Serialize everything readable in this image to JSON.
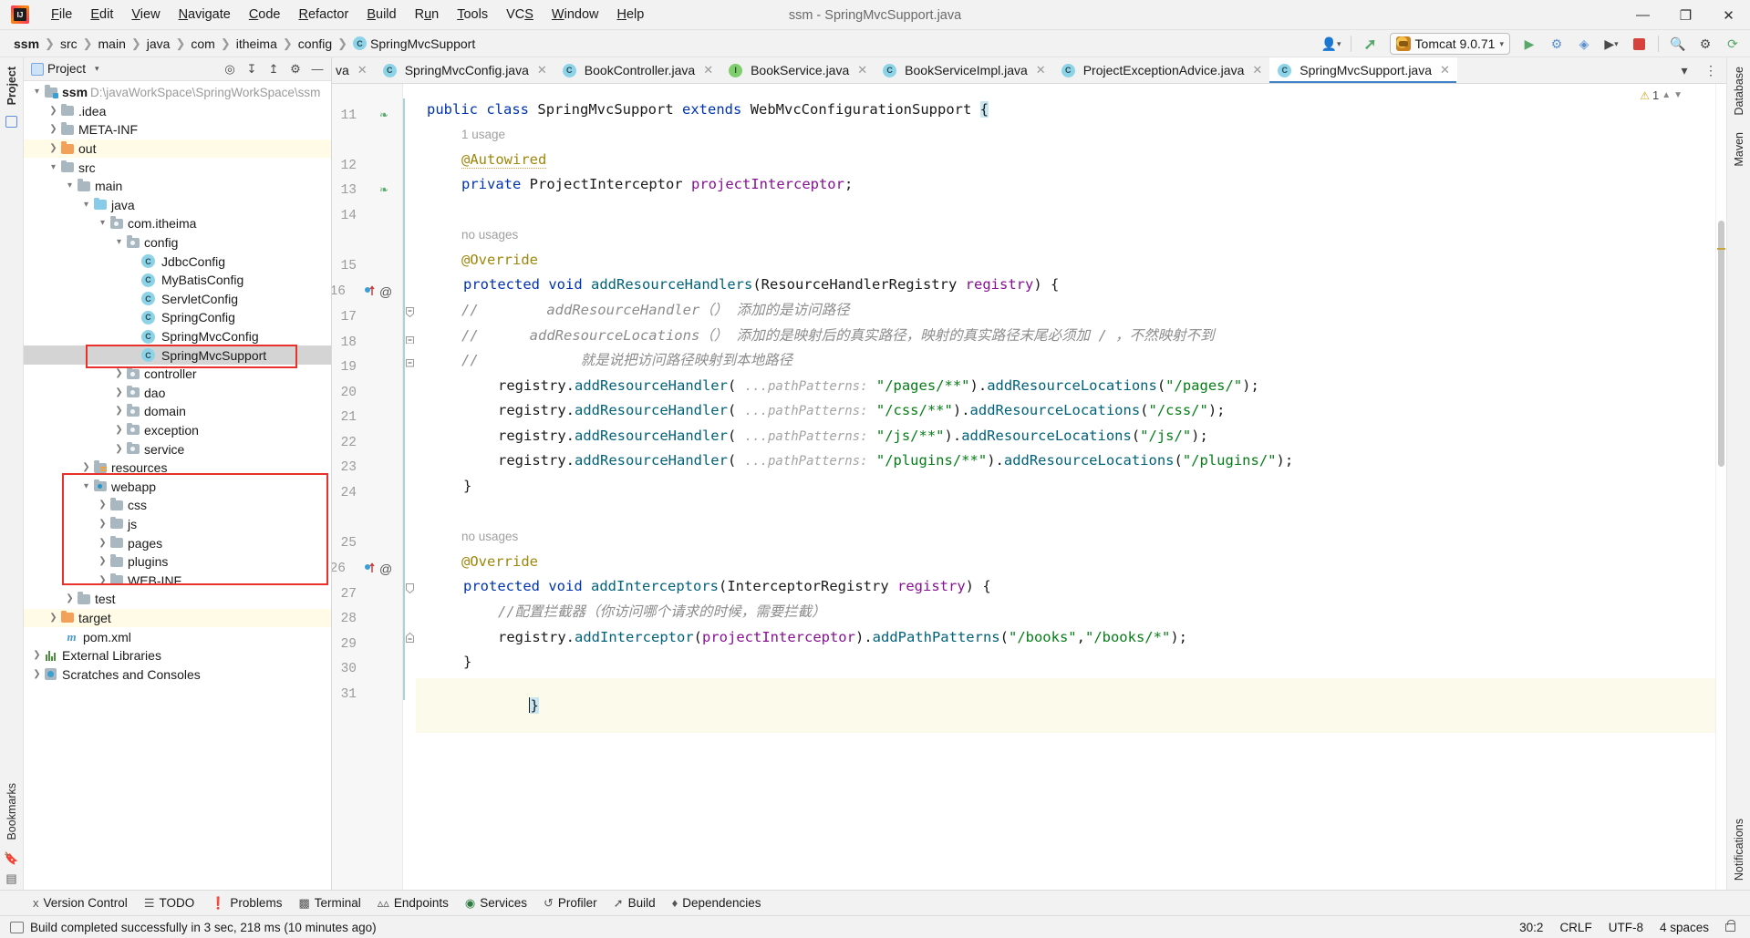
{
  "window": {
    "title": "ssm - SpringMvcSupport.java",
    "controls": {
      "minimize": "—",
      "maximize": "❐",
      "close": "✕"
    }
  },
  "menu": [
    {
      "label": "File"
    },
    {
      "label": "Edit"
    },
    {
      "label": "View"
    },
    {
      "label": "Navigate"
    },
    {
      "label": "Code"
    },
    {
      "label": "Refactor"
    },
    {
      "label": "Build"
    },
    {
      "label": "Run"
    },
    {
      "label": "Tools"
    },
    {
      "label": "VCS"
    },
    {
      "label": "Window"
    },
    {
      "label": "Help"
    }
  ],
  "breadcrumb": {
    "segments": [
      "ssm",
      "src",
      "main",
      "java",
      "com",
      "itheima",
      "config"
    ],
    "current": "SpringMvcSupport"
  },
  "toolbar": {
    "run_config": "Tomcat 9.0.71",
    "icons": [
      "profile-dropdown-icon",
      "hammer-build-icon",
      "run-icon",
      "debug-icon",
      "coverage-icon",
      "more-run-icon",
      "stop-icon",
      "search-everywhere-icon",
      "settings-icon",
      "updates-icon"
    ]
  },
  "project_panel": {
    "title": "Project",
    "header_icons": [
      "locate-icon",
      "collapse-all-icon",
      "expand-all-icon",
      "settings-icon",
      "hide-icon"
    ],
    "tree": [
      {
        "indent": 0,
        "arrow": "v",
        "icon": "module-folder",
        "label": "ssm",
        "bold": true,
        "path": "D:\\javaWorkSpace\\SpringWorkSpace\\ssm"
      },
      {
        "indent": 1,
        "arrow": ">",
        "icon": "folder",
        "label": ".idea"
      },
      {
        "indent": 1,
        "arrow": ">",
        "icon": "folder",
        "label": "META-INF"
      },
      {
        "indent": 1,
        "arrow": ">",
        "icon": "folder-orange",
        "label": "out",
        "highlight": "yellow"
      },
      {
        "indent": 1,
        "arrow": "v",
        "icon": "folder",
        "label": "src"
      },
      {
        "indent": 2,
        "arrow": "v",
        "icon": "folder",
        "label": "main"
      },
      {
        "indent": 3,
        "arrow": "v",
        "icon": "folder-blue",
        "label": "java"
      },
      {
        "indent": 4,
        "arrow": "v",
        "icon": "package",
        "label": "com.itheima"
      },
      {
        "indent": 5,
        "arrow": "v",
        "icon": "package",
        "label": "config"
      },
      {
        "indent": 6,
        "arrow": "",
        "icon": "class",
        "label": "JdbcConfig"
      },
      {
        "indent": 6,
        "arrow": "",
        "icon": "class",
        "label": "MyBatisConfig"
      },
      {
        "indent": 6,
        "arrow": "",
        "icon": "class",
        "label": "ServletConfig"
      },
      {
        "indent": 6,
        "arrow": "",
        "icon": "class",
        "label": "SpringConfig"
      },
      {
        "indent": 6,
        "arrow": "",
        "icon": "class",
        "label": "SpringMvcConfig"
      },
      {
        "indent": 6,
        "arrow": "",
        "icon": "class",
        "label": "SpringMvcSupport",
        "selected": true
      },
      {
        "indent": 5,
        "arrow": ">",
        "icon": "package",
        "label": "controller"
      },
      {
        "indent": 5,
        "arrow": ">",
        "icon": "package",
        "label": "dao"
      },
      {
        "indent": 5,
        "arrow": ">",
        "icon": "package",
        "label": "domain"
      },
      {
        "indent": 5,
        "arrow": ">",
        "icon": "package",
        "label": "exception"
      },
      {
        "indent": 5,
        "arrow": ">",
        "icon": "package",
        "label": "service"
      },
      {
        "indent": 3,
        "arrow": ">",
        "icon": "resources",
        "label": "resources"
      },
      {
        "indent": 3,
        "arrow": "v",
        "icon": "webapp",
        "label": "webapp"
      },
      {
        "indent": 4,
        "arrow": ">",
        "icon": "folder",
        "label": "css"
      },
      {
        "indent": 4,
        "arrow": ">",
        "icon": "folder",
        "label": "js"
      },
      {
        "indent": 4,
        "arrow": ">",
        "icon": "folder",
        "label": "pages"
      },
      {
        "indent": 4,
        "arrow": ">",
        "icon": "folder",
        "label": "plugins"
      },
      {
        "indent": 4,
        "arrow": ">",
        "icon": "folder",
        "label": "WEB-INF"
      },
      {
        "indent": 2,
        "arrow": ">",
        "icon": "folder",
        "label": "test"
      },
      {
        "indent": 1,
        "arrow": ">",
        "icon": "folder-orange",
        "label": "target",
        "highlight": "yellow"
      },
      {
        "indent": 1,
        "arrow": "",
        "icon": "maven",
        "label": "pom.xml"
      },
      {
        "indent": 0,
        "arrow": ">",
        "icon": "libraries",
        "label": "External Libraries"
      },
      {
        "indent": 0,
        "arrow": ">",
        "icon": "scratches",
        "label": "Scratches and Consoles"
      }
    ]
  },
  "editor": {
    "tabs": [
      {
        "label": "va",
        "icon": "class",
        "clipped": true,
        "active": false
      },
      {
        "label": "SpringMvcConfig.java",
        "icon": "class",
        "active": false
      },
      {
        "label": "BookController.java",
        "icon": "class",
        "active": false
      },
      {
        "label": "BookService.java",
        "icon": "interface",
        "active": false
      },
      {
        "label": "BookServiceImpl.java",
        "icon": "class",
        "active": false
      },
      {
        "label": "ProjectExceptionAdvice.java",
        "icon": "class",
        "active": false
      },
      {
        "label": "SpringMvcSupport.java",
        "icon": "class",
        "active": true
      }
    ],
    "warning_count": "1",
    "lines": [
      {
        "num": "11",
        "gutter": "bean"
      },
      {
        "num": "12",
        "inlay": "1 usage"
      },
      {
        "num": "13",
        "gutter": "bean"
      },
      {
        "num": "14"
      },
      {
        "num": "15",
        "inlay": "no usages"
      },
      {
        "num": "16",
        "gutter": "override-at"
      },
      {
        "num": "17"
      },
      {
        "num": "18"
      },
      {
        "num": "19"
      },
      {
        "num": "20"
      },
      {
        "num": "21"
      },
      {
        "num": "22"
      },
      {
        "num": "23"
      },
      {
        "num": "24"
      },
      {
        "num": "25",
        "inlay": "no usages"
      },
      {
        "num": "26",
        "gutter": "override-at"
      },
      {
        "num": "27"
      },
      {
        "num": "28"
      },
      {
        "num": "29"
      },
      {
        "num": "30",
        "current": true
      },
      {
        "num": "31"
      }
    ],
    "code": {
      "l11": "public class SpringMvcSupport extends WebMvcConfigurationSupport {",
      "usage1": "1 usage",
      "l12": "@Autowired",
      "l13": "private ProjectInterceptor projectInterceptor;",
      "nousages1": "no usages",
      "l15": "@Override",
      "l16": "protected void addResourceHandlers(ResourceHandlerRegistry registry) {",
      "l17": "//        addResourceHandler（） 添加的是访问路径",
      "l18": "//      addResourceLocations（） 添加的是映射后的真实路径，映射的真实路径末尾必须加 / ，不然映射不到",
      "l19": "//            就是说把访问路径映射到本地路径",
      "l20": "registry.addResourceHandler(",
      "l20_hint": "...pathPatterns:",
      "l20_p1": "\"/pages/**\"",
      "l20_rest": ").addResourceLocations(",
      "l20_p2": "\"/pages/\"",
      "l20_end": ");",
      "l21_p1": "\"/css/**\"",
      "l21_p2": "\"/css/\"",
      "l22_p1": "\"/js/**\"",
      "l22_p2": "\"/js/\"",
      "l23_p1": "\"/plugins/**\"",
      "l23_p2": "\"/plugins/\"",
      "l24": "}",
      "nousages2": "no usages",
      "l25": "@Override",
      "l26": "protected void addInterceptors(InterceptorRegistry registry) {",
      "l27": "//配置拦截器（你访问哪个请求的时候，需要拦截）",
      "l28_a": "registry.addInterceptor(",
      "l28_b": "projectInterceptor",
      "l28_c": ").addPathPatterns(",
      "l28_p1": "\"/books\"",
      "l28_p2": "\"/books/*\"",
      "l28_end": ");",
      "l29": "}",
      "l30": "}"
    }
  },
  "rails": {
    "left": [
      "Project",
      "Bookmarks"
    ],
    "right": [
      "Database",
      "Maven",
      "Notifications"
    ]
  },
  "bottom_tools": [
    {
      "label": "Version Control",
      "icon": "branch-icon"
    },
    {
      "label": "TODO",
      "icon": "list-icon"
    },
    {
      "label": "Problems",
      "icon": "error-icon"
    },
    {
      "label": "Terminal",
      "icon": "terminal-icon"
    },
    {
      "label": "Endpoints",
      "icon": "endpoints-icon"
    },
    {
      "label": "Services",
      "icon": "services-icon"
    },
    {
      "label": "Profiler",
      "icon": "profiler-icon"
    },
    {
      "label": "Build",
      "icon": "build-icon"
    },
    {
      "label": "Dependencies",
      "icon": "dependencies-icon"
    }
  ],
  "statusbar": {
    "message": "Build completed successfully in 3 sec, 218 ms (10 minutes ago)",
    "caret": "30:2",
    "line_sep": "CRLF",
    "encoding": "UTF-8",
    "indent": "4 spaces"
  },
  "colors": {
    "accent": "#4083c9",
    "annotation_box": "#e8312a",
    "keyword": "#0033b3",
    "string": "#067d17",
    "annotation": "#9e880d",
    "field": "#871094",
    "comment": "#8c8c8c",
    "method": "#00627a"
  }
}
